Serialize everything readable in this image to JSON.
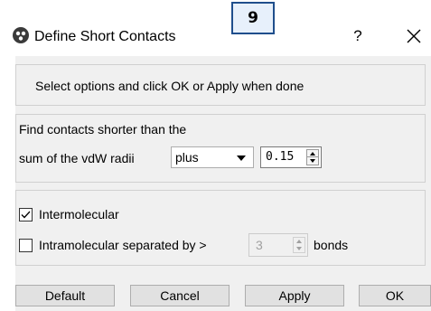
{
  "window": {
    "title": "Define Short Contacts",
    "step_badge": "9",
    "help_label": "?"
  },
  "hint": {
    "text": "Select options and click OK or Apply when done"
  },
  "contacts": {
    "line1": "Find contacts shorter than the",
    "line2": "sum of the vdW radii",
    "mode_value": "plus",
    "offset_value": "0.15"
  },
  "molecular": {
    "intermolecular_label": "Intermolecular",
    "intermolecular_checked": true,
    "intramolecular_label": "Intramolecular separated by >",
    "intramolecular_checked": false,
    "bond_count": "3",
    "bonds_label": "bonds"
  },
  "buttons": {
    "default": "Default",
    "cancel": "Cancel",
    "apply": "Apply",
    "ok": "OK"
  }
}
